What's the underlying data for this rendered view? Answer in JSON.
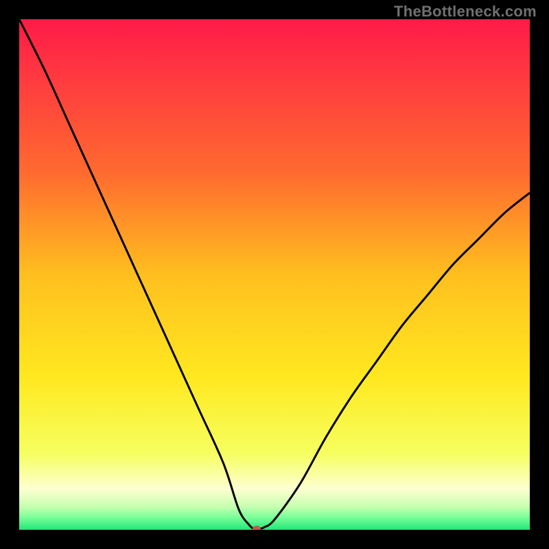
{
  "watermark": "TheBottleneck.com",
  "chart_data": {
    "type": "line",
    "title": "",
    "xlabel": "",
    "ylabel": "",
    "xlim": [
      0,
      100
    ],
    "ylim": [
      0,
      100
    ],
    "grid": false,
    "legend": null,
    "background_gradient": {
      "stops": [
        {
          "pos": 0.0,
          "color": "#ff1a47"
        },
        {
          "pos": 0.12,
          "color": "#ff3b3f"
        },
        {
          "pos": 0.3,
          "color": "#ff6a2f"
        },
        {
          "pos": 0.5,
          "color": "#ffbf1f"
        },
        {
          "pos": 0.7,
          "color": "#ffe81f"
        },
        {
          "pos": 0.85,
          "color": "#f6ff5f"
        },
        {
          "pos": 0.92,
          "color": "#fdffd0"
        },
        {
          "pos": 0.955,
          "color": "#c6ffb0"
        },
        {
          "pos": 0.975,
          "color": "#7dff9a"
        },
        {
          "pos": 1.0,
          "color": "#1fe87a"
        }
      ]
    },
    "series": [
      {
        "name": "bottleneck-curve",
        "stroke": "#000000",
        "x": [
          0,
          5,
          10,
          15,
          20,
          25,
          30,
          35,
          40,
          43,
          45,
          46,
          47,
          48,
          50,
          55,
          60,
          65,
          70,
          75,
          80,
          85,
          90,
          95,
          100
        ],
        "values": [
          100,
          90,
          79,
          68,
          57,
          46,
          35,
          24,
          13,
          4,
          1,
          0.2,
          0.2,
          0.5,
          2,
          9,
          18,
          26,
          33,
          40,
          46,
          52,
          57,
          62,
          66
        ]
      }
    ],
    "marker": {
      "name": "optimal-point",
      "x": 46.5,
      "y": 0.2,
      "color": "#c05b4e",
      "rx": 6,
      "ry": 4.5
    }
  }
}
